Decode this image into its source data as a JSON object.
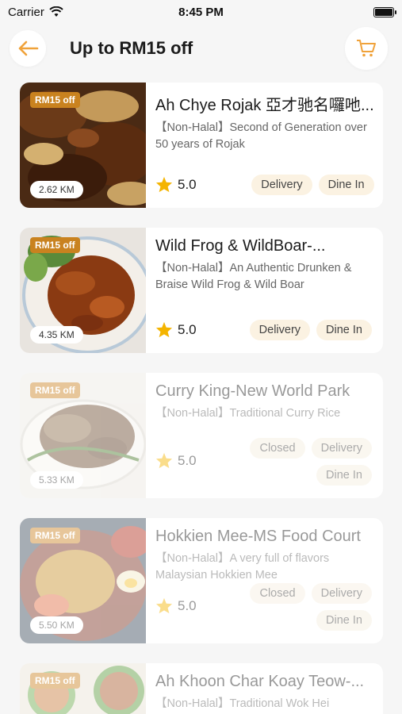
{
  "status_bar": {
    "carrier": "Carrier",
    "time": "8:45 PM"
  },
  "header": {
    "title": "Up to RM15 off"
  },
  "colors": {
    "accent": "#f0a23a",
    "badge": "#c9821f",
    "tag_bg": "#fbf2e2",
    "star": "#f4b400"
  },
  "restaurants": [
    {
      "promo": "RM15 off",
      "distance": "2.62 KM",
      "name": "Ah Chye Rojak 亞才驰名囉吔...",
      "description": "【Non-Halal】Second of Generation over 50 years of Rojak",
      "rating": "5.0",
      "closed_label": "",
      "tags": [
        "Delivery",
        "Dine In"
      ]
    },
    {
      "promo": "RM15 off",
      "distance": "4.35 KM",
      "name": "Wild Frog & WildBoar-...",
      "description": "【Non-Halal】An Authentic Drunken & Braise Wild Frog & Wild Boar",
      "rating": "5.0",
      "closed_label": "",
      "tags": [
        "Delivery",
        "Dine In"
      ]
    },
    {
      "promo": "RM15 off",
      "distance": "5.33 KM",
      "name": "Curry King-New World Park",
      "description": "【Non-Halal】Traditional Curry Rice",
      "rating": "5.0",
      "closed_label": "Closed",
      "tags": [
        "Delivery",
        "Dine In"
      ]
    },
    {
      "promo": "RM15 off",
      "distance": "5.50 KM",
      "name": "Hokkien Mee-MS Food Court",
      "description": "【Non-Halal】A very full of flavors Malaysian Hokkien Mee",
      "rating": "5.0",
      "closed_label": "Closed",
      "tags": [
        "Delivery",
        "Dine In"
      ]
    },
    {
      "promo": "RM15 off",
      "distance": "",
      "name": "Ah Khoon Char Koay Teow-...",
      "description": "【Non-Halal】Traditional Wok Hei",
      "rating": "",
      "closed_label": "",
      "tags": []
    }
  ]
}
